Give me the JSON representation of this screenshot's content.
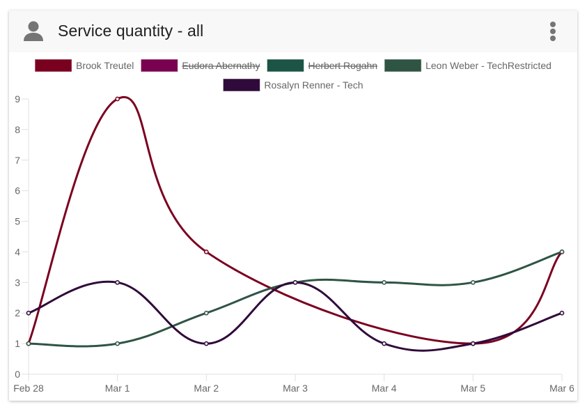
{
  "card": {
    "title": "Service quantity - all",
    "header_icon": "user-icon",
    "menu_icon": "more-vert-icon"
  },
  "chart_data": {
    "type": "line",
    "title": "Service quantity - all",
    "xlabel": "",
    "ylabel": "",
    "x": [
      "Feb 28",
      "Mar 1",
      "Mar 2",
      "Mar 3",
      "Mar 4",
      "Mar 5",
      "Mar 6"
    ],
    "ylim": [
      0,
      9
    ],
    "yticks": [
      0,
      1,
      2,
      3,
      4,
      5,
      6,
      7,
      8,
      9
    ],
    "grid": false,
    "legend_position": "top",
    "smooth": true,
    "series": [
      {
        "name": "Brook Treutel",
        "color": "#7a0020",
        "hidden": false,
        "values": [
          1,
          9,
          4,
          null,
          null,
          1,
          4
        ]
      },
      {
        "name": "Eudora Abernathy",
        "color": "#7a0050",
        "hidden": true,
        "values": []
      },
      {
        "name": "Herbert Rogahn",
        "color": "#1c5445",
        "hidden": true,
        "values": []
      },
      {
        "name": "Leon Weber - TechRestricted",
        "color": "#2f5443",
        "hidden": false,
        "values": [
          1,
          1,
          2,
          3,
          3,
          3,
          4
        ]
      },
      {
        "name": "Rosalyn Renner - Tech",
        "color": "#300a3a",
        "hidden": false,
        "values": [
          2,
          3,
          1,
          3,
          1,
          1,
          2
        ]
      }
    ]
  }
}
